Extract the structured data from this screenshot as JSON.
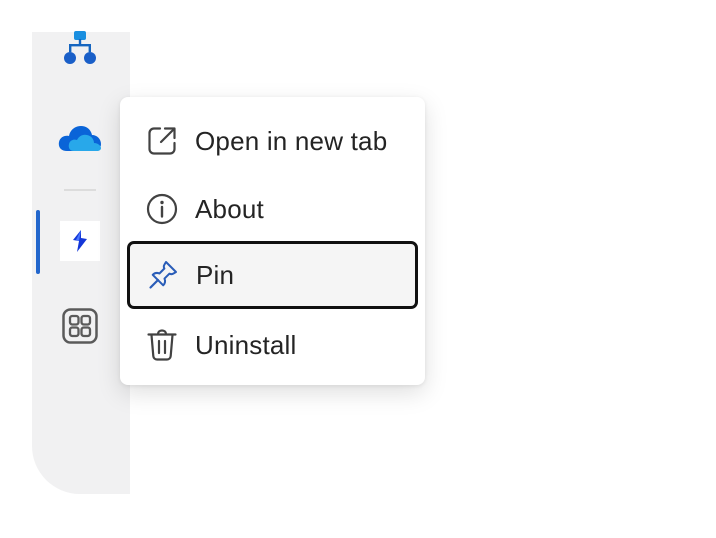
{
  "colors": {
    "rail_background": "#f1f1f2",
    "accent": "#2266cc",
    "menu_text": "#242424",
    "focus_border": "#111111"
  },
  "sidebar": {
    "items": [
      {
        "icon": "org-chart-icon"
      },
      {
        "icon": "onedrive-cloud-icon"
      },
      {
        "icon": "app-lightning-icon",
        "active": true
      },
      {
        "icon": "apps-grid-icon"
      }
    ]
  },
  "context_menu": {
    "items": [
      {
        "icon": "open-external-icon",
        "label": "Open in new tab"
      },
      {
        "icon": "info-icon",
        "label": "About"
      },
      {
        "icon": "pin-icon",
        "label": "Pin",
        "focused": true
      },
      {
        "icon": "trash-icon",
        "label": "Uninstall"
      }
    ]
  }
}
